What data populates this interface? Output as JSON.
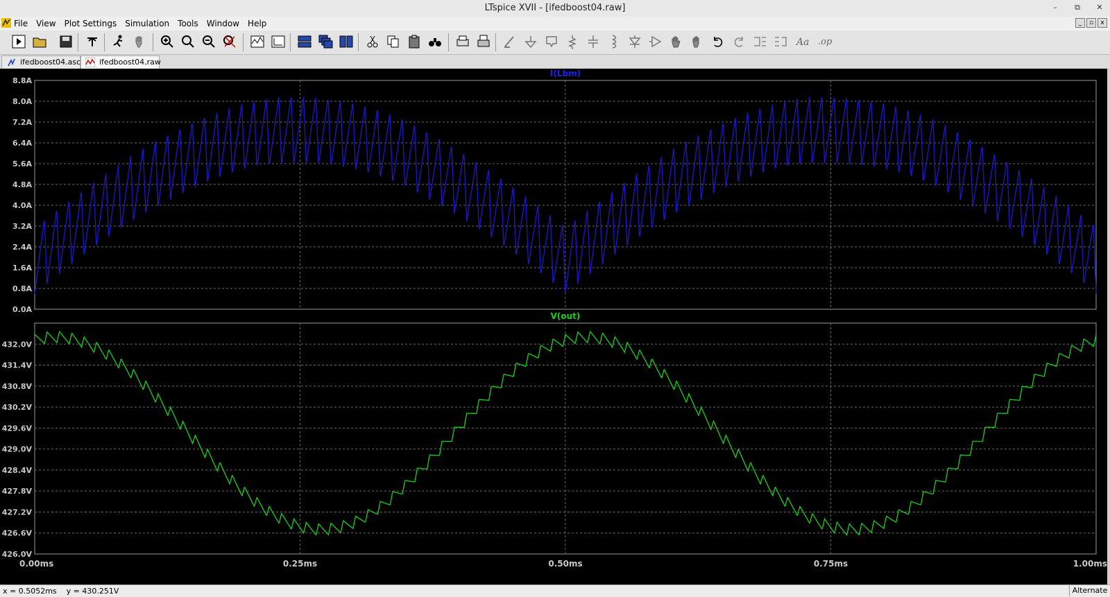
{
  "window": {
    "title": "LTspice XVII - [ifedboost04.raw]"
  },
  "menu": [
    "File",
    "View",
    "Plot Settings",
    "Simulation",
    "Tools",
    "Window",
    "Help"
  ],
  "tabs": [
    {
      "label": "ifedboost04.asc",
      "active": false
    },
    {
      "label": "ifedboost04.raw",
      "active": true
    }
  ],
  "toolbar": [
    "run",
    "open",
    "save",
    "control-panel",
    "halt",
    "pan",
    "zoom-area",
    "zoom-in",
    "zoom-out",
    "zoom-full",
    "autorange",
    "manual-limits",
    "tile-horizontal",
    "cascade",
    "tile-vertical",
    "cut",
    "copy",
    "paste",
    "find",
    "print-preview",
    "print",
    "draw-wire",
    "ground",
    "label-net",
    "resistor",
    "capacitor",
    "inductor",
    "diode",
    "component",
    "move",
    "drag",
    "undo",
    "redo",
    "rotate",
    "mirror",
    "text",
    "spice-directive"
  ],
  "colors": {
    "trace_top": "#1a1acc",
    "trace_bottom": "#14d414",
    "grid": "#6a6a6a",
    "axis_text": "#c8c8c8",
    "background": "#000000"
  },
  "chart_data": [
    {
      "type": "line",
      "title": "I(Lbm)",
      "title_color": "#2020e0",
      "x_ticks": [
        "0.00ms",
        "0.25ms",
        "0.50ms",
        "0.75ms",
        "1.00ms"
      ],
      "xlim": [
        0,
        1.0
      ],
      "y_ticks": [
        "0.0A",
        "0.8A",
        "1.6A",
        "2.4A",
        "3.2A",
        "4.0A",
        "4.8A",
        "5.6A",
        "6.4A",
        "7.2A",
        "8.0A",
        "8.8A"
      ],
      "ylim": [
        0,
        8.8
      ],
      "grid": true,
      "series": [
        {
          "color": "#1a1acc",
          "description": "triangular ripple riding on rectified sine",
          "envelope_center": {
            "x": [
              0,
              0.25,
              0.5,
              0.75,
              1.0
            ],
            "y": [
              1.9,
              6.9,
              1.9,
              6.9,
              1.9
            ]
          },
          "ripple_peak_to_peak": 2.6,
          "switching_periods_per_half_cycle": 43
        }
      ]
    },
    {
      "type": "line",
      "title": "V(out)",
      "title_color": "#14d414",
      "x_ticks": [
        "0.00ms",
        "0.25ms",
        "0.50ms",
        "0.75ms",
        "1.00ms"
      ],
      "xlim": [
        0,
        1.0
      ],
      "y_ticks": [
        "426.0V",
        "426.6V",
        "427.2V",
        "427.8V",
        "428.4V",
        "429.0V",
        "429.6V",
        "430.2V",
        "430.8V",
        "431.4V",
        "432.0V"
      ],
      "ylim": [
        426.0,
        432.6
      ],
      "grid": true,
      "series": [
        {
          "color": "#14d414",
          "description": "sinusoidal bus voltage with small switching ripple",
          "x": [
            0,
            0.02,
            0.25,
            0.52,
            0.75,
            1.0
          ],
          "y": [
            432.0,
            432.2,
            426.7,
            432.2,
            426.7,
            432.0
          ],
          "ripple_amplitude": 0.18
        }
      ]
    }
  ],
  "status": {
    "x": "x = 0.5052ms",
    "y": "y = 430.251V",
    "mode": "Alternate"
  }
}
